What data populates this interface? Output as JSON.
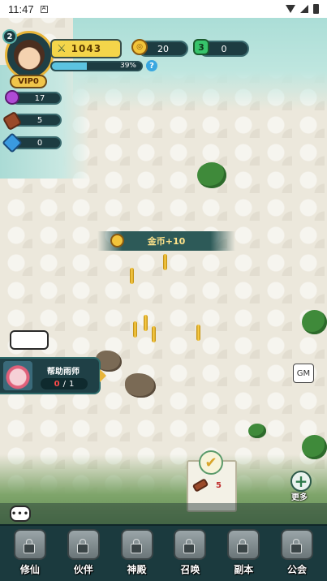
{
  "status_bar": {
    "time": "11:47",
    "notification_icon": "A"
  },
  "player": {
    "level": "2",
    "vip": "VIP0",
    "power": "1043",
    "exp_text": "39%",
    "exp_fraction": 0.39
  },
  "currencies": {
    "gold": "20",
    "jade": "0",
    "jade_icon": "3"
  },
  "resources": {
    "gem": "17",
    "wood": "5",
    "crystal": "0"
  },
  "reward_banner": "金币+10",
  "quest": {
    "title": "帮助雨师",
    "current": "0",
    "separator": "/",
    "total": "1"
  },
  "gm_label": "GM",
  "more_label": "更多",
  "task_card": {
    "wood_count": "5"
  },
  "chat_label": "•••",
  "nav": [
    {
      "label": "修仙",
      "icon": "cultivation-icon"
    },
    {
      "label": "伙伴",
      "icon": "partner-icon"
    },
    {
      "label": "神殿",
      "icon": "temple-icon"
    },
    {
      "label": "召唤",
      "icon": "summon-icon"
    },
    {
      "label": "副本",
      "icon": "dungeon-icon"
    },
    {
      "label": "公会",
      "icon": "guild-icon"
    }
  ],
  "colors": {
    "panel": "#1d3c41",
    "gold": "#f2c43a",
    "accent": "#e8b53a"
  }
}
